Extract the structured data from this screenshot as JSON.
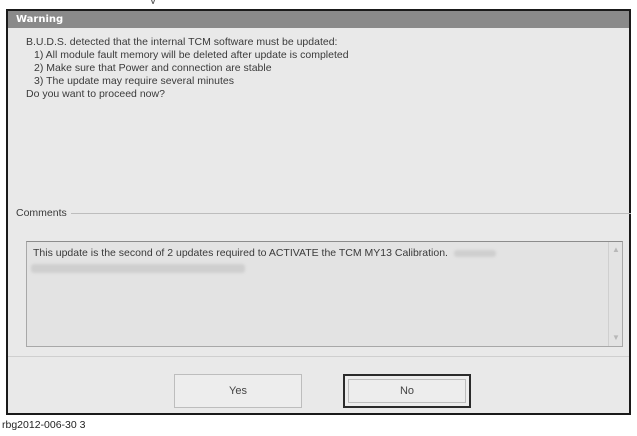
{
  "dialog": {
    "title": "Warning",
    "message_lines": [
      "B.U.D.S. detected that the internal TCM software must be updated:",
      "1) All module fault memory will be deleted after update is completed",
      "2) Make sure that Power and connection are stable",
      "3) The update may require several minutes",
      "Do you want to proceed now?"
    ],
    "comments_label": "Comments",
    "comments_text": "This update is the second of 2 updates required to ACTIVATE the TCM MY13 Calibration.",
    "yes_label": "Yes",
    "no_label": "No"
  },
  "caption": "rbg2012-006-30 3",
  "icons": {
    "scroll_up": "scroll-up-arrow",
    "scroll_down": "scroll-down-arrow"
  },
  "colors": {
    "title_bar": "#8a8a8a",
    "dialog_bg": "#e9e9e9",
    "border": "#1a1a1a"
  }
}
